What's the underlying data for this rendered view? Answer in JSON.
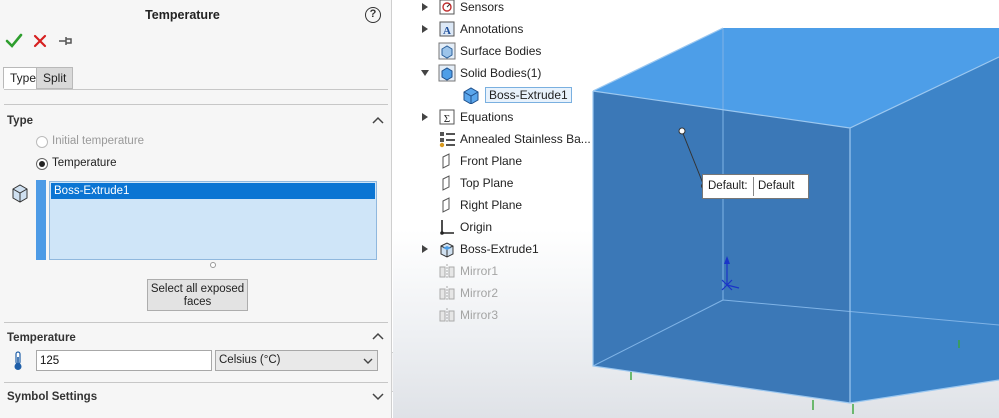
{
  "property_manager": {
    "title": "Temperature",
    "tabs": [
      "Type",
      "Split"
    ],
    "type_section": {
      "title": "Type",
      "options": [
        {
          "label": "Initial temperature",
          "selected": false,
          "enabled": false
        },
        {
          "label": "Temperature",
          "selected": true,
          "enabled": true
        }
      ],
      "selection_items": [
        "Boss-Extrude1"
      ],
      "select_all_button": "Select all exposed faces"
    },
    "temperature_section": {
      "title": "Temperature",
      "value": "125",
      "unit": "Celsius (°C)"
    },
    "symbol_section": {
      "title": "Symbol Settings"
    }
  },
  "feature_tree": {
    "items": [
      {
        "label": "Sensors",
        "expandable": true,
        "icon": "sensors-icon",
        "dim": false
      },
      {
        "label": "Annotations",
        "expandable": true,
        "icon": "annotations-icon",
        "dim": false
      },
      {
        "label": "Surface Bodies",
        "expandable": false,
        "icon": "surface-bodies-icon",
        "dim": false
      },
      {
        "label": "Solid Bodies(1)",
        "expandable": true,
        "expanded": true,
        "icon": "solid-bodies-icon",
        "dim": false
      },
      {
        "label": "Boss-Extrude1",
        "expandable": false,
        "icon": "solid-body-icon",
        "dim": false,
        "child": true
      },
      {
        "label": "Equations",
        "expandable": true,
        "icon": "equations-icon",
        "dim": false
      },
      {
        "label": "Annealed Stainless Ba...",
        "expandable": false,
        "icon": "material-icon",
        "dim": false
      },
      {
        "label": "Front Plane",
        "expandable": false,
        "icon": "plane-icon",
        "dim": false
      },
      {
        "label": "Top Plane",
        "expandable": false,
        "icon": "plane-icon",
        "dim": false
      },
      {
        "label": "Right Plane",
        "expandable": false,
        "icon": "plane-icon",
        "dim": false
      },
      {
        "label": "Origin",
        "expandable": false,
        "icon": "origin-icon",
        "dim": false
      },
      {
        "label": "Boss-Extrude1",
        "expandable": true,
        "icon": "extrude-feature-icon",
        "dim": false
      },
      {
        "label": "Mirror1",
        "expandable": false,
        "icon": "mirror-icon",
        "dim": true
      },
      {
        "label": "Mirror2",
        "expandable": false,
        "icon": "mirror-icon",
        "dim": true
      },
      {
        "label": "Mirror3",
        "expandable": false,
        "icon": "mirror-icon",
        "dim": true
      }
    ]
  },
  "callout": {
    "key": "Default:",
    "value": "Default"
  },
  "colors": {
    "accent": "#0b75d3",
    "cube_front": "#3b78b7",
    "cube_top": "#4d9ee8",
    "cube_side": "#3d84c8",
    "ok_green": "#2e9e2e",
    "cancel_red": "#d62020"
  }
}
